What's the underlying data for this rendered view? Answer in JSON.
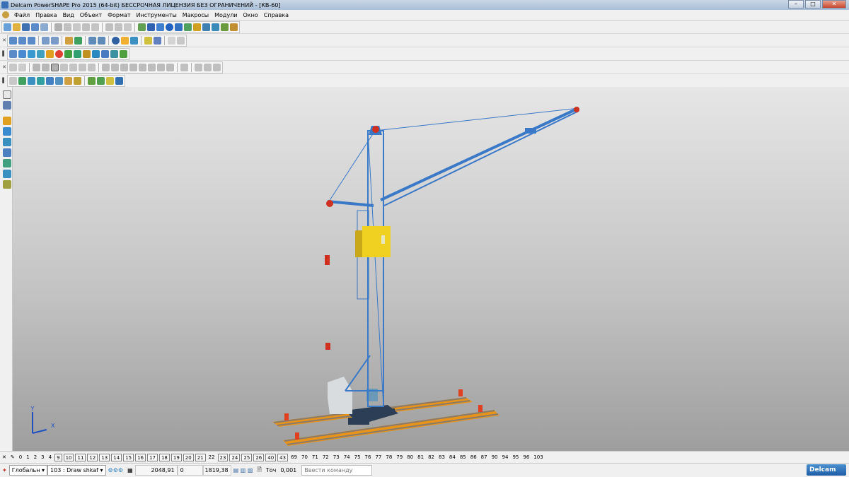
{
  "window": {
    "title": "Delcam PowerSHAPE Pro 2015 (64-bit) БЕССРОЧНАЯ ЛИЦЕНЗИЯ БЕЗ ОГРАНИЧЕНИЙ - [КВ-60]",
    "minimize": "–",
    "maximize": "□",
    "close": "✕"
  },
  "menu": {
    "items": [
      "Файл",
      "Правка",
      "Вид",
      "Объект",
      "Формат",
      "Инструменты",
      "Макросы",
      "Модули",
      "Окно",
      "Справка"
    ]
  },
  "mdi": {
    "minimize": "–",
    "restore": "▫",
    "close": "✕"
  },
  "viewport": {
    "axis": {
      "y_label": "Y",
      "x_label": "X"
    },
    "colors": {
      "tower": "#3a78c8",
      "cab": "#f0d020",
      "rails": "#e8941a",
      "rail_top": "#8a7a6a",
      "counterweight": "#d8dcdf",
      "stops": "#e04020",
      "hooks": "#d03020",
      "base": "#2c3e55"
    }
  },
  "levels": [
    "0",
    "1",
    "2",
    "3",
    "4",
    "9",
    "10",
    "11",
    "12",
    "13",
    "14",
    "15",
    "16",
    "17",
    "18",
    "19",
    "20",
    "21",
    "22",
    "23",
    "24",
    "25",
    "26",
    "40",
    "43",
    "69",
    "70",
    "71",
    "72",
    "73",
    "74",
    "75",
    "76",
    "77",
    "78",
    "79",
    "80",
    "81",
    "82",
    "83",
    "84",
    "85",
    "86",
    "87",
    "90",
    "94",
    "95",
    "96",
    "103"
  ],
  "levels_boxed": [
    "9",
    "10",
    "11",
    "12",
    "13",
    "14",
    "15",
    "16",
    "17",
    "18",
    "19",
    "20",
    "21",
    "23",
    "24",
    "25",
    "26",
    "40",
    "43"
  ],
  "status": {
    "workplane": "Глобальн",
    "drawing": "103 : Draw shkaf",
    "coord_x": "2048,91",
    "coord_y": "0",
    "coord_z": "1819,38",
    "tolerance_label": "Точ",
    "tolerance_value": "0,001",
    "command_placeholder": "Ввести команду"
  },
  "brand": "Delcam"
}
